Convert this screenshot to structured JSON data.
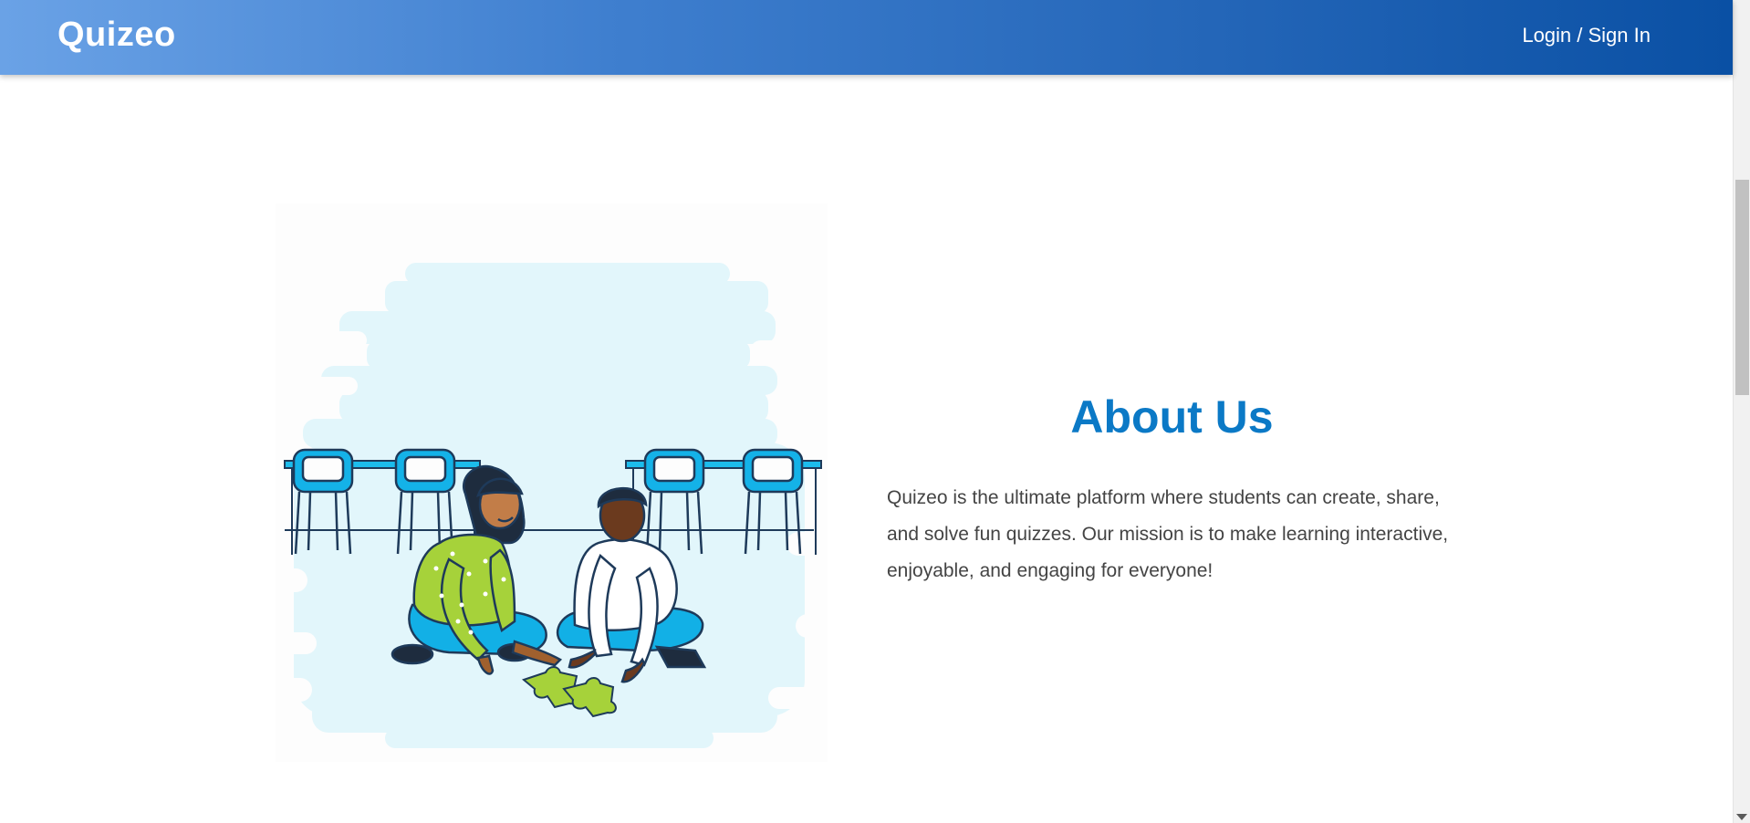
{
  "header": {
    "logo": "Quizeo",
    "login_label": "Login / Sign In"
  },
  "about": {
    "title": "About Us",
    "description": "Quizeo is the ultimate platform where students can create, share, and solve fun quizzes. Our mission is to make learning interactive, enjoyable, and engaging for everyone!"
  },
  "illustration": {
    "subject": "two students solving a jigsaw puzzle on the classroom floor",
    "icon": "students-puzzle-illustration"
  },
  "colors": {
    "header_start": "#6aa2e6",
    "header_end": "#0a50a4",
    "title": "#0b79c6",
    "text": "#444444",
    "chair": "#12b4ec",
    "puzzle": "#a6d23a",
    "cloud": "#e2f6fb"
  }
}
